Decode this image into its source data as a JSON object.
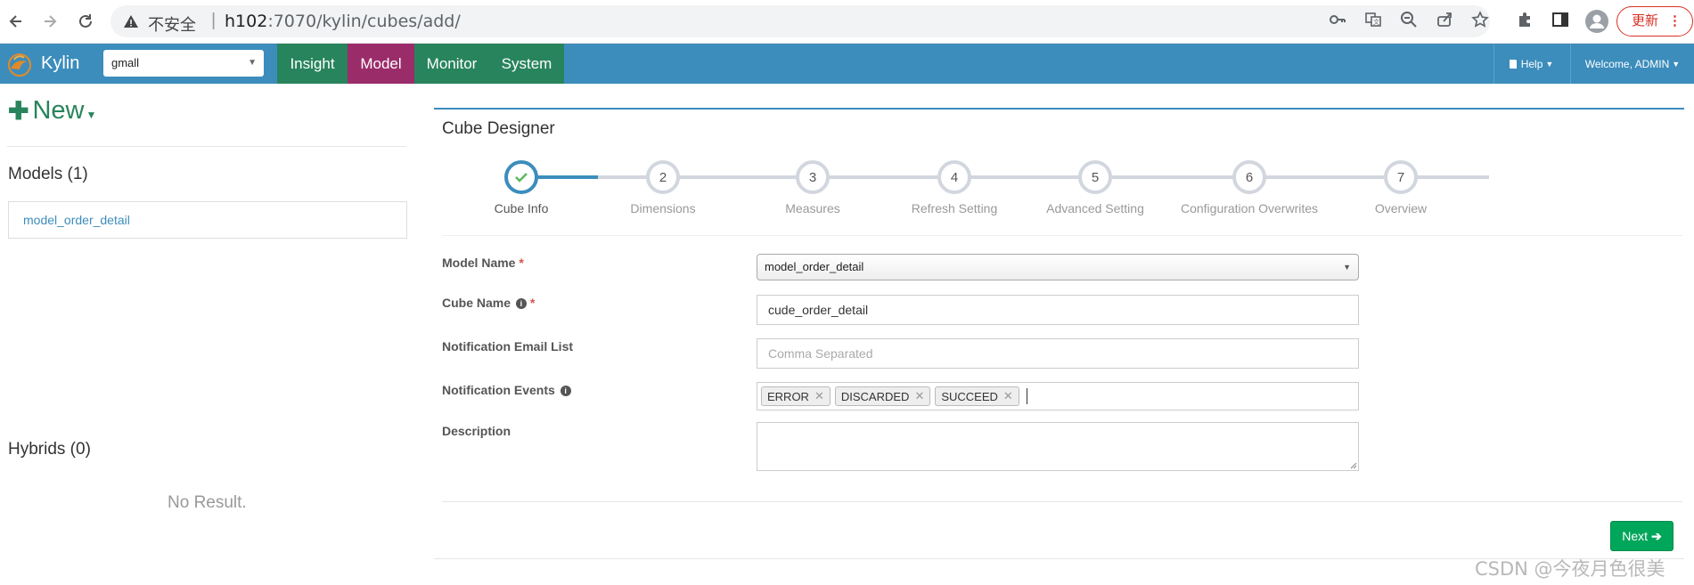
{
  "browser": {
    "insecure_label": "不安全",
    "url_host": "h102",
    "url_rest": ":7070/kylin/cubes/add/",
    "update_label": "更新"
  },
  "nav": {
    "brand": "Kylin",
    "project": "gmall",
    "menu": [
      "Insight",
      "Model",
      "Monitor",
      "System"
    ],
    "active_menu": "Model",
    "help": "Help",
    "welcome": "Welcome, ADMIN"
  },
  "sidebar": {
    "new_label": "New",
    "models_title": "Models (1)",
    "models": [
      "model_order_detail"
    ],
    "hybrids_title": "Hybrids (0)",
    "no_result": "No Result."
  },
  "designer": {
    "title": "Cube Designer",
    "steps": [
      {
        "num": "1",
        "label": "Cube Info"
      },
      {
        "num": "2",
        "label": "Dimensions"
      },
      {
        "num": "3",
        "label": "Measures"
      },
      {
        "num": "4",
        "label": "Refresh Setting"
      },
      {
        "num": "5",
        "label": "Advanced Setting"
      },
      {
        "num": "6",
        "label": "Configuration Overwrites"
      },
      {
        "num": "7",
        "label": "Overview"
      }
    ],
    "current_step": 1,
    "form": {
      "model_name_label": "Model Name",
      "model_name_value": "model_order_detail",
      "cube_name_label": "Cube Name",
      "cube_name_value": "cude_order_detail",
      "email_label": "Notification Email List",
      "email_placeholder": "Comma Separated",
      "events_label": "Notification Events",
      "events": [
        "ERROR",
        "DISCARDED",
        "SUCCEED"
      ],
      "description_label": "Description",
      "required_mark": "*"
    },
    "next_label": "Next"
  },
  "watermark": "CSDN @今夜月色很美",
  "colors": {
    "nav_blue": "#3c8dbc",
    "menu_green": "#28845c",
    "menu_active": "#9b2c6a",
    "success": "#00a65a",
    "required": "#d9534f"
  }
}
